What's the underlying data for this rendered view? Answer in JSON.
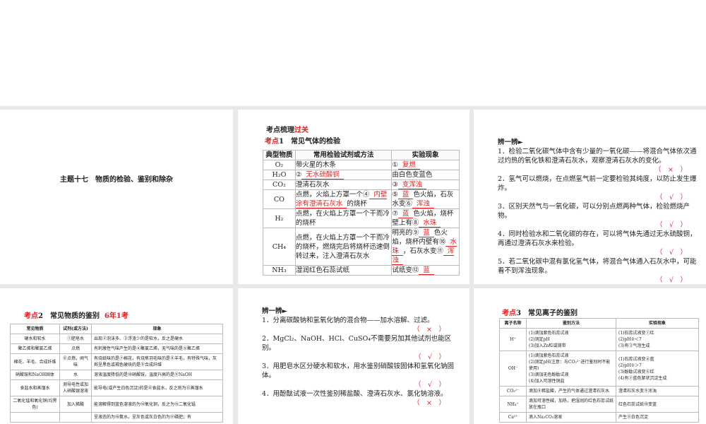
{
  "slide1": {
    "title": "主题十七　物质的检验、鉴别和除杂"
  },
  "slide2": {
    "section_a": "考点梳理",
    "section_b": "过关",
    "kd": "考点",
    "kd_rest": "1　常见气体的检验",
    "headers": [
      "典型物质",
      "常用检验试剂或方法",
      "实验现象"
    ],
    "rows": [
      {
        "sub": "O₂",
        "method": "带火星的木条",
        "result_pre": "①",
        "result_ans": "复燃",
        "result_post": ""
      },
      {
        "sub": "H₂O",
        "method_pre": "②",
        "method_ans": "无水硫酸铜",
        "result": "由白色变蓝色"
      },
      {
        "sub": "CO₂",
        "method": "澄清石灰水",
        "result_pre": "③",
        "result_ans": "变浑浊"
      },
      {
        "sub": "CO",
        "method_pre": "点燃，火焰上方罩一个④",
        "method_ans": "内壁涂有澄清石灰水",
        "method_post": "的烧杯",
        "r1": "⑤",
        "a1": "蓝",
        "r2": "色火焰，石灰水变⑥",
        "a2": "浑浊"
      },
      {
        "sub": "H₂",
        "method": "点燃，在火焰上方罩一个干而冷的烧杯",
        "r1": "⑦",
        "a1": "蓝",
        "r2": "色火焰，烧杯壁上有⑧",
        "a2": "水珠"
      },
      {
        "sub": "CH₄",
        "method": "点燃，在火焰上方罩一个干而冷的烧杯，燃烧完后将烧杯迅速倒转过来，注入澄清石灰水",
        "r1": "明亮的⑨",
        "a1": "蓝",
        "r2": "色火焰，烧杯内壁有⑩",
        "a2": "水珠",
        "r3": "，石灰水变⑪",
        "a3": "浑浊"
      },
      {
        "sub": "NH₃",
        "method": "湿润红色石蕊试纸",
        "result_pre": "试纸变⑫",
        "result_ans": "蓝"
      }
    ]
  },
  "slide3": {
    "heading": "辨一辨►",
    "items": [
      {
        "text": "1．检验二氧化碳气体中含有少量的一氧化碳——将混合气体依次通过灼热的氧化铁和澄清石灰水，观察澄清石灰水的变化。",
        "mark": "（　×　）"
      },
      {
        "text": "2．氢气可以燃烧，在点燃氢气前一定要检验其纯度，以防止发生爆炸。",
        "mark": "（　√　）"
      },
      {
        "text": "3．区别天然气与一氧化碳，可以分别点燃两种气体，检验燃烧产物。",
        "mark": "（　√　）"
      },
      {
        "text": "4．同时检验水和二氧化碳的存在，可以将气体先通过无水硫酸铜，再通过澄清石灰水来检验。",
        "mark": "（　√　）"
      },
      {
        "text": "5．若二氧化碳中混有氯化氢气体，将混合气体通入石灰水中，可能看不到浑浊现象。",
        "mark": "（　√　）"
      }
    ]
  },
  "slide4": {
    "kd": "考点",
    "kd_rest": "2　常见物质的鉴别",
    "freq": "6年1考",
    "headers": [
      "常见物质",
      "试剂(或方法)",
      "现象"
    ],
    "rows": [
      [
        "硬水和软水",
        "①肥皂水",
        "出现②泡沫多、③浮渣少的是软水，反之是硬水"
      ],
      [
        "聚乙烯和聚氯乙烯",
        "点燃",
        "有刺激性气味产生的是④聚氯乙烯，无气味的是⑤聚乙烯"
      ],
      [
        "棉花、羊毛、合成纤维",
        "⑥点燃，闻气味",
        "有烧纸味的是⑦棉花，有烧焦羽毛味的是⑧羊毛，有特殊气味，灰烬呈黑色或褐色硬块的是⑨合成纤维"
      ],
      [
        "硝酸铵和NaOH固体",
        "水",
        "溶液温度降低的是⑩硝酸铵，温度升高的是⑪NaOH"
      ],
      [
        "食盐水和蒸馏水",
        "测导电性或加入硝酸银溶液",
        "能导电(或产生白色沉淀)的是⑫食盐水，反之则为⑬蒸馏水"
      ],
      [
        "二氧化锰和氧化铜(均黑色)",
        "加入稀酸",
        "能溶解得到蓝色溶液的为⑭氧化铜，反之为⑮二氧化锰"
      ],
      [
        "",
        "",
        "呈液态的为⑯氨水，呈灰色或灰白色的为⑰磷肥；有"
      ]
    ]
  },
  "slide5": {
    "heading": "辨一辨►",
    "items": [
      {
        "text": "1．分离碳酸钠和氢氧化钠的混合物——加水溶解、过滤。",
        "mark": "（　×　）"
      },
      {
        "text": "2．MgCl₂、NaOH、HCl、CuSO₄不需要另加其他试剂也能区别。",
        "mark": "（　√　）"
      },
      {
        "text": "3．用肥皂水区分硬水和软水，用水鉴别硝酸铵固体和氢氧化钠固体。",
        "mark": "（　√　）"
      },
      {
        "text": "4．用酚酞试液一次性鉴别稀盐酸、澄清石灰水、氯化钠溶液。",
        "mark": "（　×　）"
      }
    ]
  },
  "slide6": {
    "kd": "考点",
    "kd_rest": "3　常见离子的鉴别",
    "headers": [
      "离子名称",
      "鉴别方法",
      "实验现象"
    ],
    "rows": [
      [
        "H⁺",
        "(1)滴加紫色石蕊试液\n(2)测定pH\n(3)加入Zn粒或镁带",
        "(1)石蕊试液变①红\n(2)pH②＜7\n(3)有③气泡生成"
      ],
      [
        "OH⁻",
        "(1)滴加紫色石蕊试液\n(2)测定pH(注意：与CO₃²⁻进行鉴别时不能使用)\n(3)滴加无色酚酞试液\n(4)加入可溶性铜盐",
        "(1)石蕊试液变④蓝\n(2)pH⑤＞7\n(3)酚酞试液变⑥红\n(4)有⑦蓝色絮状沉淀生成"
      ],
      [
        "CO₃²⁻",
        "滴加⑧稀盐酸，产生的气体通过澄清石灰水",
        "澄清石灰水变⑨浑浊"
      ],
      [
        "NH₄⁺",
        "滴加可溶性碱，加热，把湿润的红色石蕊试纸放在瓶口",
        "红色石蕊试纸⑩变蓝"
      ],
      [
        "Ca²⁺",
        "滴入Na₂CO₃溶液",
        "产生⑪白色沉淀"
      ]
    ]
  }
}
